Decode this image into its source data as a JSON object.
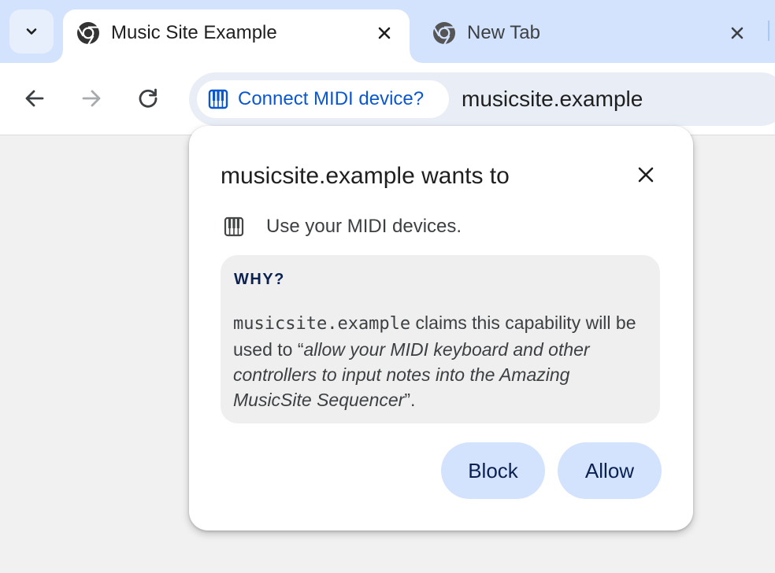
{
  "browser": {
    "tabs": [
      {
        "title": "Music Site Example",
        "active": true,
        "favicon": "chrome-icon"
      },
      {
        "title": "New Tab",
        "active": false,
        "favicon": "chrome-icon"
      }
    ],
    "tab_search_icon": "chevron-down-icon"
  },
  "toolbar": {
    "back_icon": "arrow-left-icon",
    "forward_icon": "arrow-right-icon",
    "reload_icon": "reload-icon",
    "chip": {
      "icon": "piano-keys-icon",
      "label": "Connect MIDI device?"
    },
    "url": "musicsite.example"
  },
  "permission_prompt": {
    "title": "musicsite.example wants to",
    "permission_icon": "piano-keys-icon",
    "permission_text": "Use your MIDI devices.",
    "why": {
      "heading": "WHY?",
      "origin": "musicsite.example",
      "claim_prefix": " claims this capability will be used to “",
      "purpose": "allow your MIDI keyboard and other controllers to input notes into the Amazing MusicSite Sequencer",
      "claim_suffix": "”."
    },
    "buttons": {
      "block": "Block",
      "allow": "Allow"
    }
  },
  "colors": {
    "tabstrip": "#d3e3fd",
    "accent_blue": "#0b57d0",
    "button_bg": "#d3e3fd",
    "button_text": "#0a2152",
    "omnibox_bg": "#e9eef6"
  }
}
